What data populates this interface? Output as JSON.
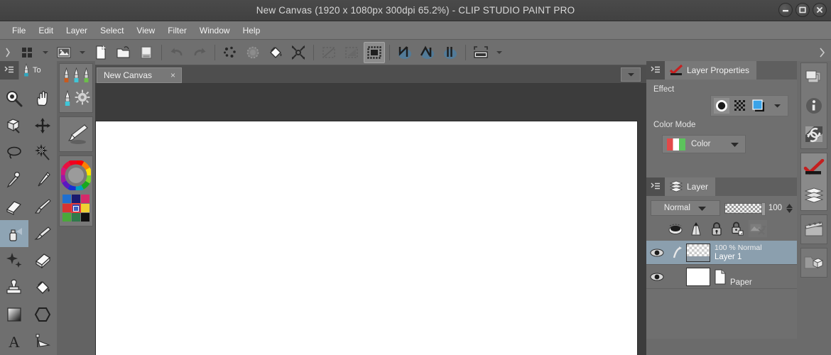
{
  "window": {
    "title": "New Canvas (1920 x 1080px 300dpi 65.2%)  - CLIP STUDIO PAINT PRO",
    "controls": [
      {
        "name": "minimize-button",
        "glyph": "minimize"
      },
      {
        "name": "maximize-button",
        "glyph": "maximize"
      },
      {
        "name": "close-button",
        "glyph": "close"
      }
    ]
  },
  "menubar": {
    "items": [
      "File",
      "Edit",
      "Layer",
      "Select",
      "View",
      "Filter",
      "Window",
      "Help"
    ]
  },
  "command_bar": {
    "buttons": [
      {
        "name": "grid-view-icon",
        "label": "Quick Access"
      },
      {
        "name": "chevron-down-icon",
        "label": "Quick Access Options"
      },
      {
        "name": "image-icon",
        "label": "Material"
      },
      {
        "name": "chevron-down-icon",
        "label": "Material Options"
      },
      {
        "name": "new-file-icon",
        "label": "New"
      },
      {
        "name": "open-folder-icon",
        "label": "Open"
      },
      {
        "name": "save-icon",
        "label": "Save"
      },
      {
        "name": "undo-icon",
        "label": "Undo"
      },
      {
        "name": "redo-icon",
        "label": "Redo"
      },
      {
        "name": "clear-icon",
        "label": "Clear"
      },
      {
        "name": "fill-selection-icon",
        "label": "Fill"
      },
      {
        "name": "bucket-fill-icon",
        "label": "Fill Bucket"
      },
      {
        "name": "transform-icon",
        "label": "Scale/Rotate"
      },
      {
        "name": "select-all-icon",
        "label": "Select All"
      },
      {
        "name": "deselect-icon",
        "label": "Deselect"
      },
      {
        "name": "invert-selection-icon",
        "label": "Invert Selection"
      },
      {
        "name": "snap-ruler-icon",
        "label": "Snap to Special Ruler"
      },
      {
        "name": "snap-perspective-icon",
        "label": "Snap to Perspective Ruler"
      },
      {
        "name": "snap-grid-icon",
        "label": "Snap to Grid"
      },
      {
        "name": "canvas-settings-icon",
        "label": "Change Canvas Settings"
      },
      {
        "name": "chevron-down-icon",
        "label": "More"
      }
    ],
    "overflow_label": "More Commands"
  },
  "tool_palette": {
    "tab_label": "To",
    "tab_label_full": "Tool",
    "grip_name": "palette-grip",
    "tools": [
      {
        "name": "zoom-tool",
        "label": "Zoom"
      },
      {
        "name": "move-hand-tool",
        "label": "Move"
      },
      {
        "name": "rotate-canvas-tool",
        "label": "Rotate"
      },
      {
        "name": "move-layer-tool",
        "label": "Move layer"
      },
      {
        "name": "selection-lasso-tool",
        "label": "Selection area"
      },
      {
        "name": "auto-select-tool",
        "label": "Auto select"
      },
      {
        "name": "eyedropper-tool",
        "label": "Eyedropper"
      },
      {
        "name": "pen-tool",
        "label": "Pen"
      },
      {
        "name": "eraser-tool",
        "label": "Eraser"
      },
      {
        "name": "blend-tool",
        "label": "Blend"
      },
      {
        "name": "airbrush-tool",
        "label": "Airbrush",
        "selected": true
      },
      {
        "name": "brush-tool",
        "label": "Brush"
      },
      {
        "name": "decoration-tool",
        "label": "Decoration"
      },
      {
        "name": "eraser-block-tool",
        "label": "Eraser"
      },
      {
        "name": "stamp-tool",
        "label": "Stamp"
      },
      {
        "name": "fill-tool",
        "label": "Fill"
      },
      {
        "name": "gradient-tool",
        "label": "Gradient"
      },
      {
        "name": "figure-tool",
        "label": "Figure"
      },
      {
        "name": "text-tool",
        "label": "Text"
      },
      {
        "name": "ruler-tool",
        "label": "Ruler"
      }
    ]
  },
  "sub_tool_column": {
    "pens": [
      {
        "name": "pen-preset-g-pen",
        "color": "#c85a1e"
      },
      {
        "name": "pen-preset-mapping-pen",
        "color": "#3fc6d8"
      },
      {
        "name": "pen-preset-turnip-pen",
        "color": "#6bbf4a"
      },
      {
        "name": "pen-preset-marker",
        "color": "#3fc6d8"
      },
      {
        "name": "pen-preset-settings",
        "color": "#b8b8b8"
      }
    ],
    "brush": {
      "name": "brush-preset-icon",
      "label": "Brush"
    },
    "color_wheel": {
      "name": "color-wheel",
      "label": "Color Wheel"
    },
    "swatches": {
      "name": "color-swatch-grid",
      "colors": [
        "#1f6fd0",
        "#1a1a6e",
        "#d62a6a",
        "#d83232",
        "#2f46b0",
        "#f0d032",
        "#4aa83a",
        "#2f7a4a",
        "#101010"
      ],
      "selected_index": 4
    }
  },
  "document": {
    "tab": {
      "label": "New Canvas",
      "close_glyph": "×"
    },
    "tab_dropdown_name": "tab-list-dropdown",
    "canvas_name": "canvas-page"
  },
  "layer_properties": {
    "tab_label": "Layer Properties",
    "effect_label": "Effect",
    "effect_buttons": [
      {
        "name": "effect-none-button",
        "label": "None",
        "selected": true
      },
      {
        "name": "effect-screen-tone-button",
        "label": "Tone",
        "selected": false
      },
      {
        "name": "effect-border-button",
        "label": "Border effect",
        "selected": false
      }
    ],
    "effect_dropdown_name": "effect-options-dropdown",
    "color_mode_label": "Color Mode",
    "color_mode_value": "Color"
  },
  "layer_panel": {
    "tab_label": "Layer",
    "blend_mode": "Normal",
    "opacity_value": "100",
    "buttons": [
      {
        "name": "palette-color-button",
        "label": "Palette color"
      },
      {
        "name": "clipping-mask-button",
        "label": "Clip at layer below"
      },
      {
        "name": "lock-layer-button",
        "label": "Lock layer"
      },
      {
        "name": "lock-transparent-pixels-button",
        "label": "Lock transparent pixels"
      },
      {
        "name": "layer-mask-button",
        "label": "Layer mask"
      }
    ],
    "rows": [
      {
        "name": "layer-row-layer1",
        "meta": "100 %  Normal",
        "title": "Layer 1",
        "thumb": "checker",
        "selected": true,
        "has_clip_indicator": true
      },
      {
        "name": "layer-row-paper",
        "meta": "",
        "title": "Paper",
        "thumb": "white",
        "selected": false,
        "has_clip_indicator": false
      }
    ]
  },
  "icon_rail": {
    "groups": [
      [
        {
          "name": "navigator-icon",
          "label": "Navigator"
        },
        {
          "name": "info-icon",
          "label": "Information"
        },
        {
          "name": "history-icon",
          "label": "History"
        }
      ],
      [
        {
          "name": "layer-properties-icon",
          "label": "Layer Properties",
          "active": true
        },
        {
          "name": "layers-icon",
          "label": "Layer",
          "active": true
        }
      ],
      [
        {
          "name": "animation-icon",
          "label": "Timeline"
        }
      ],
      [
        {
          "name": "materials-icon",
          "label": "Material"
        }
      ]
    ]
  }
}
